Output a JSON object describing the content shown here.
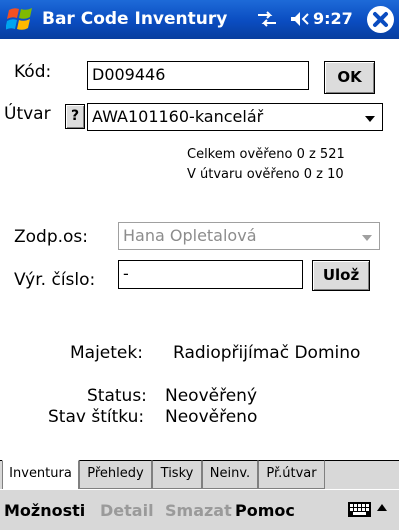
{
  "titlebar": {
    "title": "Bar Code Inventury",
    "time": "9:27"
  },
  "form": {
    "kod_label": "Kód:",
    "kod_value": "D009446",
    "ok_label": "OK",
    "utvar_label": "Útvar",
    "help_label": "?",
    "utvar_value": "AWA101160-kancelář",
    "total_verified": "Celkem ověřeno 0 z 521",
    "unit_verified": "V útvaru ověřeno 0 z 10",
    "zodp_label": "Zodp.os:",
    "zodp_value": "Hana Opletalová",
    "vyr_label": "Výr. číslo:",
    "vyr_value": "-",
    "save_label": "Ulož",
    "majetek_label": "Majetek:",
    "majetek_value": "Radiopřijímač Domino",
    "status_label": "Status:",
    "status_value": "Neověřený",
    "stav_label": "Stav štítku:",
    "stav_value": "Neověřeno"
  },
  "tabs": [
    {
      "label": "Inventura",
      "active": true
    },
    {
      "label": "Přehledy",
      "active": false
    },
    {
      "label": "Tisky",
      "active": false
    },
    {
      "label": "Neinv.",
      "active": false
    },
    {
      "label": "Př.útvar",
      "active": false
    }
  ],
  "menu": {
    "moznosti": "Možnosti",
    "detail": "Detail",
    "smazat": "Smazat",
    "pomoc": "Pomoc"
  },
  "icons": {
    "start": "windows-flag-icon",
    "connectivity": "connectivity-icon",
    "volume": "speaker-icon",
    "close": "close-icon",
    "keyboard": "keyboard-icon",
    "sip_arrow": "up-arrow-icon"
  },
  "colors": {
    "titlebar": "#0a4cc0",
    "menubar": "#d8d8d8",
    "disabled_text": "#9a9a9a"
  }
}
